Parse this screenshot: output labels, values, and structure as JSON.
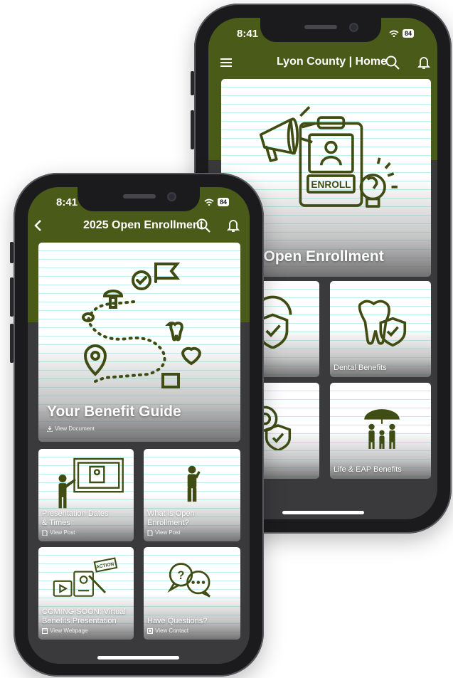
{
  "colors": {
    "brand_green": "#4a5a18",
    "icon_green": "#3f4d14",
    "screen_bg": "#3a3a3c"
  },
  "back_phone": {
    "status": {
      "time": "8:41",
      "battery": "84"
    },
    "nav": {
      "title": "Lyon County | Home",
      "menu_icon": "hamburger-menu-icon",
      "search_icon": "search-icon",
      "bell_icon": "bell-icon"
    },
    "hero": {
      "title_visible": "5 Open Enrollment",
      "icon": "enroll-clipboard-megaphone-icon"
    },
    "tiles": [
      {
        "label": "nefits",
        "icon": "shield-check-icon"
      },
      {
        "label": "Dental Benefits",
        "icon": "tooth-shield-icon"
      },
      {
        "label": "efits",
        "icon": "vision-shield-icon"
      },
      {
        "label": "Life & EAP Benefits",
        "icon": "family-umbrella-icon"
      }
    ]
  },
  "front_phone": {
    "status": {
      "time": "8:41",
      "battery": "84"
    },
    "nav": {
      "title": "2025 Open Enrollment",
      "back_icon": "chevron-left-icon",
      "search_icon": "search-icon",
      "bell_icon": "bell-icon"
    },
    "hero": {
      "title": "Your Benefit Guide",
      "action": "View Document",
      "action_icon": "download-icon",
      "icon": "benefit-roadmap-icon"
    },
    "tiles": [
      {
        "title_line1": "Presentation Dates",
        "title_line2": "& Times",
        "action": "View Post",
        "action_icon": "document-icon",
        "icon": "presenter-board-icon"
      },
      {
        "title_line1": "What is Open",
        "title_line2": "Enrollment?",
        "action": "View Post",
        "action_icon": "document-icon",
        "icon": "thinking-person-icon"
      },
      {
        "title_line1": "COMING SOON: Virtual",
        "title_line2": "Benefits Presentation",
        "action": "View Webpage",
        "action_icon": "webpage-icon",
        "icon": "video-action-icon"
      },
      {
        "title_line1": "Have Questions?",
        "title_line2": "",
        "action": "View Contact",
        "action_icon": "contact-icon",
        "icon": "chat-bubbles-icon"
      }
    ]
  }
}
